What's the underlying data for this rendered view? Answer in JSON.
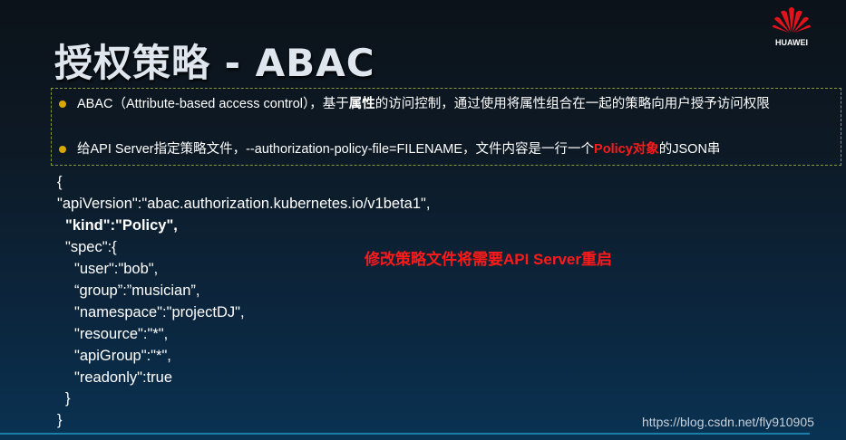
{
  "slide": {
    "title": "授权策略 - ABAC",
    "logo": {
      "text": "HUAWEI",
      "color": "#e3131b"
    },
    "bullets": [
      {
        "prefix": "ABAC（Attribute-based access control），基于",
        "bold": "属性",
        "middle": "的访问控制",
        "suffix": "，通过使用将属性组合在一起的策略向用户授予访问权限"
      },
      {
        "prefix": "给API Server指定策略文件，--authorization-policy-file=FILENAME，文件内容是一行一个",
        "red": "Policy对象",
        "suffix": "的JSON串"
      }
    ],
    "code_lines": [
      "{",
      "\"apiVersion\":\"abac.authorization.kubernetes.io/v1beta1\",",
      "\"kind\":\"Policy\",",
      "\"spec\":{",
      "\"user\":\"bob\",",
      "“group”:”musician”,",
      "\"namespace\":\"projectDJ\",",
      "\"resource\":\"*\",",
      "\"apiGroup\":\"*\",",
      "\"readonly\":true",
      "}",
      "}"
    ],
    "note": "修改策略文件将需要API Server重启",
    "watermark": "https://blog.csdn.net/fly910905",
    "colors": {
      "highlight": "#ff1a1a",
      "bullet": "#d9a800",
      "border": "#8a9a3a"
    }
  }
}
